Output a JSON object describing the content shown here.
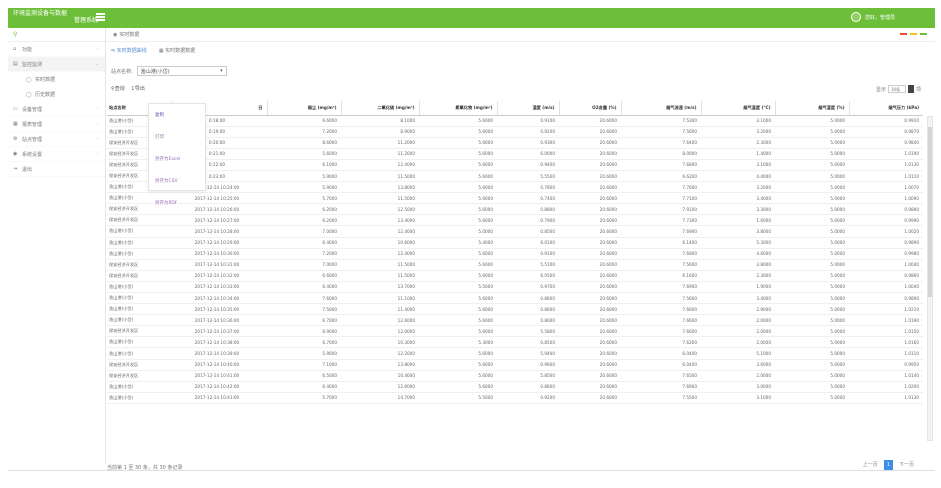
{
  "header": {
    "title_line1": "环境监测设备与数据",
    "title_line2": "管理系统",
    "user_greeting": "您好，管理员"
  },
  "sidebar": {
    "items": [
      {
        "icon": "home-icon",
        "label": "功能"
      },
      {
        "icon": "monitor-icon",
        "label": "监控监测"
      },
      {
        "icon": "realtime-icon",
        "label": "实时数据",
        "sub": true
      },
      {
        "icon": "history-icon",
        "label": "历史数据",
        "sub": true
      },
      {
        "icon": "device-icon",
        "label": "设备管理"
      },
      {
        "icon": "report-icon",
        "label": "报表管理"
      },
      {
        "icon": "station-icon",
        "label": "站点管理"
      },
      {
        "icon": "settings-icon",
        "label": "系统设置"
      },
      {
        "icon": "logout-icon",
        "label": "退出"
      }
    ]
  },
  "breadcrumb": {
    "label": "实时数据"
  },
  "status_colors": [
    "#e74c3c",
    "#f1c40f",
    "#6dbf3a"
  ],
  "tabs": [
    {
      "label": "实时数据曲线",
      "active": true
    },
    {
      "label": "实时数据数据",
      "active": false
    }
  ],
  "station": {
    "label": "站点名称:",
    "value": "渔山港(小岱)"
  },
  "actions": {
    "query": "查询",
    "export": "导出"
  },
  "export_menu": [
    "复制",
    "打印",
    "另存为Excel",
    "另存为CSV",
    "另存为PDF"
  ],
  "pagesize": {
    "label": "显示",
    "value": "30条",
    "suffix": "项"
  },
  "table": {
    "columns": [
      "站点名称",
      "日",
      "烟尘 (mg/m³)",
      "二氧化硫 (mg/m³)",
      "氮氧化物 (mg/m³)",
      "湿度 (m/s)",
      "O2含量 (%)",
      "烟气流速 (m/s)",
      "烟气温度 (°C)",
      "烟气湿度 (%)",
      "烟气压力 (kPa)"
    ],
    "rows": [
      [
        "渔山港(小岱)",
        "0:18:00",
        "6.6000",
        "8.1000",
        "5.6000",
        "0.9100",
        "20.6000",
        "7.5300",
        "3.1000",
        "5.0000",
        "0.9910"
      ],
      [
        "渔山港(小岱)",
        "0:19:00",
        "7.2000",
        "8.9000",
        "5.6000",
        "0.9200",
        "20.6000",
        "7.5600",
        "3.2000",
        "5.0000",
        "0.9870"
      ],
      [
        "保安经济开发区",
        "0:20:00",
        "8.6000",
        "11.2000",
        "5.6000",
        "0.9300",
        "20.6000",
        "7.6400",
        "2.3000",
        "5.0000",
        "0.9840"
      ],
      [
        "保安经济开发区",
        "0:21:00",
        "5.6000",
        "11.2000",
        "5.6000",
        "6.0000",
        "20.6000",
        "8.0000",
        "1.4000",
        "5.0000",
        "1.0190"
      ],
      [
        "保安经济开发区",
        "0:22:00",
        "6.1000",
        "12.4000",
        "5.6000",
        "0.9400",
        "20.6000",
        "7.6800",
        "3.1000",
        "5.0000",
        "1.0130"
      ],
      [
        "保安经济开发区",
        "0:23:00",
        "5.9000",
        "11.5000",
        "5.6000",
        "5.5500",
        "20.6000",
        "6.6200",
        "4.4000",
        "5.0000",
        "1.0110"
      ],
      [
        "渔山港(小岱)",
        "2017-12-14 10:24:00",
        "5.9000",
        "13.8000",
        "5.6000",
        "0.7800",
        "20.6000",
        "7.7600",
        "3.2000",
        "5.0000",
        "1.0070"
      ],
      [
        "渔山港(小岱)",
        "2017-12-14 10:25:00",
        "5.7000",
        "11.5000",
        "5.6000",
        "0.7400",
        "20.6000",
        "7.7100",
        "3.4000",
        "5.0000",
        "1.0090"
      ],
      [
        "保安经济开发区",
        "2017-12-14 10:26:00",
        "6.2000",
        "12.5000",
        "5.6000",
        "0.8800",
        "20.6000",
        "7.9100",
        "3.3000",
        "5.0000",
        "0.9890"
      ],
      [
        "保安经济开发区",
        "2017-12-14 10:27:00",
        "6.2000",
        "13.4000",
        "5.6000",
        "0.7900",
        "20.6000",
        "7.7300",
        "1.6000",
        "5.0000",
        "0.9990"
      ],
      [
        "渔山港(小岱)",
        "2017-12-14 10:28:00",
        "7.0000",
        "12.4000",
        "5.0000",
        "0.8500",
        "20.6000",
        "7.6900",
        "3.8000",
        "5.0000",
        "1.0020"
      ],
      [
        "渔山港(小岱)",
        "2017-12-14 10:29:00",
        "6.4000",
        "10.6000",
        "5.4000",
        "6.0100",
        "20.6000",
        "6.1400",
        "5.3000",
        "5.0000",
        "0.9890"
      ],
      [
        "渔山港(小岱)",
        "2017-12-14 10:30:00",
        "7.2000",
        "12.4000",
        "5.6000",
        "0.9100",
        "20.6000",
        "7.6800",
        "4.6000",
        "5.0000",
        "0.9980"
      ],
      [
        "保安经济开发区",
        "2017-12-14 10:31:00",
        "7.0000",
        "11.5000",
        "5.6000",
        "5.5100",
        "20.6000",
        "7.5600",
        "3.8000",
        "5.0000",
        "1.0040"
      ],
      [
        "保安经济开发区",
        "2017-12-14 10:32:00",
        "6.6000",
        "11.5000",
        "5.6000",
        "6.0500",
        "20.6000",
        "6.1600",
        "2.3000",
        "5.0000",
        "0.9860"
      ],
      [
        "渔山港(小岱)",
        "2017-12-14 10:33:00",
        "6.4000",
        "13.7000",
        "5.5000",
        "0.9700",
        "20.6000",
        "7.6900",
        "1.9000",
        "5.0000",
        "1.0040"
      ],
      [
        "渔山港(小岱)",
        "2017-12-14 10:34:00",
        "7.6000",
        "11.1000",
        "5.6000",
        "0.8600",
        "20.6000",
        "7.5600",
        "3.4000",
        "5.0000",
        "0.9890"
      ],
      [
        "渔山港(小岱)",
        "2017-12-14 10:35:00",
        "7.5000",
        "11.4000",
        "5.6000",
        "0.8600",
        "20.6000",
        "7.6600",
        "2.9000",
        "5.0000",
        "1.0210"
      ],
      [
        "渔山港(小岱)",
        "2017-12-14 10:36:00",
        "6.7000",
        "12.6000",
        "5.6000",
        "0.8600",
        "20.6000",
        "7.6600",
        "2.0000",
        "5.0000",
        "1.0190"
      ],
      [
        "保安经济开发区",
        "2017-12-14 10:37:00",
        "6.9000",
        "12.0000",
        "5.6000",
        "5.5800",
        "20.6000",
        "7.6600",
        "2.0000",
        "5.0000",
        "1.0150"
      ],
      [
        "渔山港(小岱)",
        "2017-12-14 10:38:00",
        "6.7000",
        "10.3000",
        "5.3000",
        "0.8500",
        "20.6000",
        "7.6200",
        "2.0000",
        "5.0000",
        "1.0160"
      ],
      [
        "渔山港(小岱)",
        "2017-12-14 10:39:00",
        "5.9000",
        "12.2000",
        "5.6000",
        "5.9400",
        "20.6000",
        "6.0400",
        "5.1000",
        "5.0000",
        "1.0110"
      ],
      [
        "保安经济开发区",
        "2017-12-14 10:40:00",
        "7.1000",
        "13.8000",
        "5.6000",
        "0.9600",
        "20.6000",
        "6.0400",
        "3.6000",
        "5.0000",
        "0.9950"
      ],
      [
        "保安经济开发区",
        "2017-12-14 10:41:00",
        "6.5000",
        "10.4000",
        "5.6000",
        "5.8500",
        "20.6000",
        "7.6500",
        "2.0000",
        "5.0000",
        "1.0140"
      ],
      [
        "渔山港(小岱)",
        "2017-12-14 10:42:00",
        "6.4000",
        "12.6000",
        "5.6000",
        "0.8600",
        "20.6000",
        "7.6900",
        "3.0000",
        "5.0000",
        "1.0200"
      ],
      [
        "渔山港(小岱)",
        "2017-12-14 10:43:00",
        "5.7000",
        "14.7000",
        "5.5000",
        "0.9200",
        "20.6000",
        "7.5500",
        "3.1000",
        "5.0000",
        "1.0130"
      ]
    ]
  },
  "footer": {
    "info": "当前第 1 至 30 条，共 30 条记录",
    "prev": "上一页",
    "current": "1",
    "next": "下一页"
  }
}
